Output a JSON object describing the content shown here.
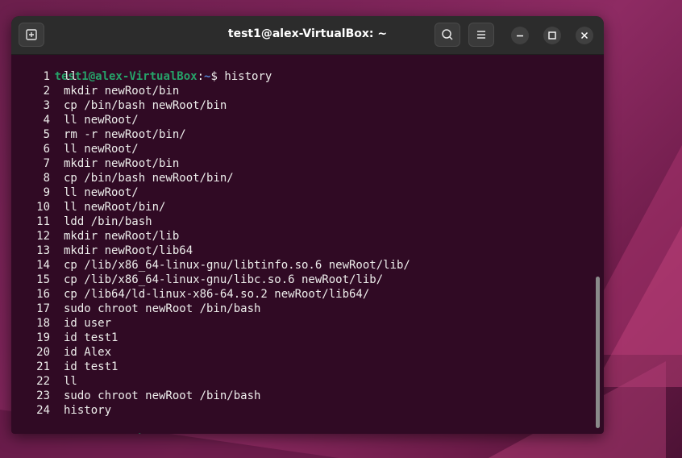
{
  "window": {
    "title": "test1@alex-VirtualBox: ~"
  },
  "icons": {
    "new_tab": "new-tab-icon",
    "search": "search-icon",
    "menu": "hamburger-menu-icon",
    "minimize": "minimize-icon",
    "maximize": "maximize-icon",
    "close": "close-icon"
  },
  "prompt": {
    "user_host": "test1@alex-VirtualBox",
    "colon": ":",
    "path": "~",
    "dollar": "$ ",
    "command": "history"
  },
  "history": [
    {
      "n": "1",
      "cmd": "ll"
    },
    {
      "n": "2",
      "cmd": "mkdir newRoot/bin"
    },
    {
      "n": "3",
      "cmd": "cp /bin/bash newRoot/bin"
    },
    {
      "n": "4",
      "cmd": "ll newRoot/"
    },
    {
      "n": "5",
      "cmd": "rm -r newRoot/bin/"
    },
    {
      "n": "6",
      "cmd": "ll newRoot/"
    },
    {
      "n": "7",
      "cmd": "mkdir newRoot/bin"
    },
    {
      "n": "8",
      "cmd": "cp /bin/bash newRoot/bin/"
    },
    {
      "n": "9",
      "cmd": "ll newRoot/"
    },
    {
      "n": "10",
      "cmd": "ll newRoot/bin/"
    },
    {
      "n": "11",
      "cmd": "ldd /bin/bash"
    },
    {
      "n": "12",
      "cmd": "mkdir newRoot/lib"
    },
    {
      "n": "13",
      "cmd": "mkdir newRoot/lib64"
    },
    {
      "n": "14",
      "cmd": "cp /lib/x86_64-linux-gnu/libtinfo.so.6 newRoot/lib/"
    },
    {
      "n": "15",
      "cmd": "cp /lib/x86_64-linux-gnu/libc.so.6 newRoot/lib/"
    },
    {
      "n": "16",
      "cmd": "cp /lib64/ld-linux-x86-64.so.2 newRoot/lib64/"
    },
    {
      "n": "17",
      "cmd": "sudo chroot newRoot /bin/bash"
    },
    {
      "n": "18",
      "cmd": "id user"
    },
    {
      "n": "19",
      "cmd": "id test1"
    },
    {
      "n": "20",
      "cmd": "id Alex"
    },
    {
      "n": "21",
      "cmd": "id test1"
    },
    {
      "n": "22",
      "cmd": "ll"
    },
    {
      "n": "23",
      "cmd": "sudo chroot newRoot /bin/bash"
    },
    {
      "n": "24",
      "cmd": "history"
    }
  ],
  "colors": {
    "terminal_bg": "#300a24",
    "prompt_user": "#26a269",
    "prompt_path": "#5285d4",
    "text": "#eeeeec"
  }
}
